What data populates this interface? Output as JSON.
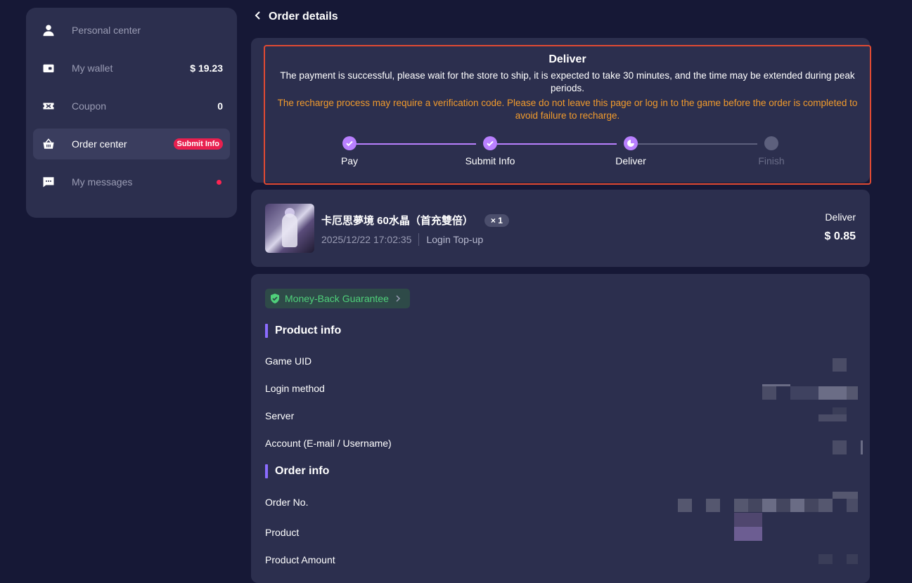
{
  "sidebar": {
    "items": [
      {
        "label": "Personal center",
        "icon": "person-icon",
        "value": ""
      },
      {
        "label": "My wallet",
        "icon": "wallet-icon",
        "value": "$ 19.23"
      },
      {
        "label": "Coupon",
        "icon": "ticket-icon",
        "value": "0"
      },
      {
        "label": "Order center",
        "icon": "basket-icon",
        "badge": "Submit Info"
      },
      {
        "label": "My messages",
        "icon": "message-icon",
        "value": ""
      }
    ]
  },
  "header": {
    "title": "Order details"
  },
  "status": {
    "title": "Deliver",
    "message": "The payment is successful, please wait for the store to ship, it is expected to take 30 minutes, and the time may be extended during peak periods.",
    "warning": "The recharge process may require a verification code. Please do not leave this page or log in to the game before the order is completed to avoid failure to recharge.",
    "steps": [
      {
        "label": "Pay",
        "state": "done"
      },
      {
        "label": "Submit Info",
        "state": "done"
      },
      {
        "label": "Deliver",
        "state": "current"
      },
      {
        "label": "Finish",
        "state": "todo"
      }
    ]
  },
  "product": {
    "name": "卡厄思夢境 60水晶（首充雙倍）",
    "quantity": "× 1",
    "date": "2025/12/22 17:02:35",
    "mode": "Login Top-up",
    "status": "Deliver",
    "price": "$ 0.85"
  },
  "guarantee": {
    "label": "Money-Back Guarantee"
  },
  "product_info": {
    "title": "Product info",
    "rows": [
      "Game UID",
      "Login method",
      "Server",
      "Account (E-mail / Username)"
    ]
  },
  "order_info": {
    "title": "Order info",
    "rows": [
      "Order No.",
      "Product",
      "Product Amount"
    ]
  },
  "colors": {
    "accent": "#b980ff",
    "warning": "#f29b2c",
    "danger": "#e8204f",
    "success": "#4fd07a",
    "highlight_border": "#e04a33"
  }
}
